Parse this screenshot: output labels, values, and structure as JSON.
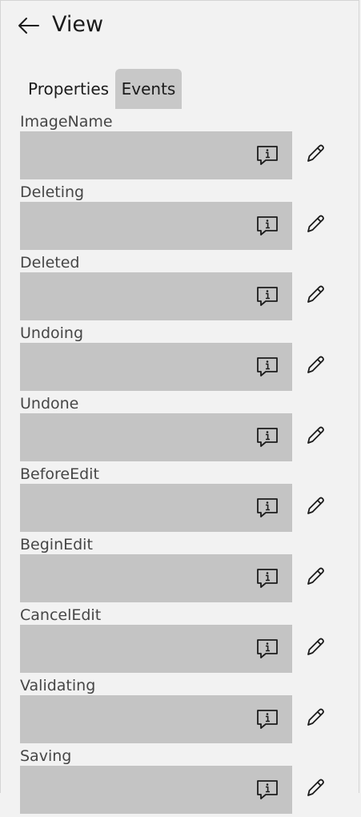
{
  "header": {
    "title": "View",
    "back_icon": "arrow-left-icon"
  },
  "tabs": [
    {
      "label": "Properties",
      "active": false
    },
    {
      "label": "Events",
      "active": true
    }
  ],
  "fields": [
    {
      "label": "ImageName",
      "value": ""
    },
    {
      "label": "Deleting",
      "value": ""
    },
    {
      "label": "Deleted",
      "value": ""
    },
    {
      "label": "Undoing",
      "value": ""
    },
    {
      "label": "Undone",
      "value": ""
    },
    {
      "label": "BeforeEdit",
      "value": ""
    },
    {
      "label": "BeginEdit",
      "value": ""
    },
    {
      "label": "CancelEdit",
      "value": ""
    },
    {
      "label": "Validating",
      "value": ""
    },
    {
      "label": "Saving",
      "value": ""
    }
  ],
  "icons": {
    "info": "info-comment-icon",
    "edit": "pencil-icon"
  },
  "colors": {
    "background": "#f2f2f2",
    "field": "#c4c4c4",
    "active_tab": "#c8c8c8",
    "text": "#1b1b1b",
    "label": "#464646"
  }
}
